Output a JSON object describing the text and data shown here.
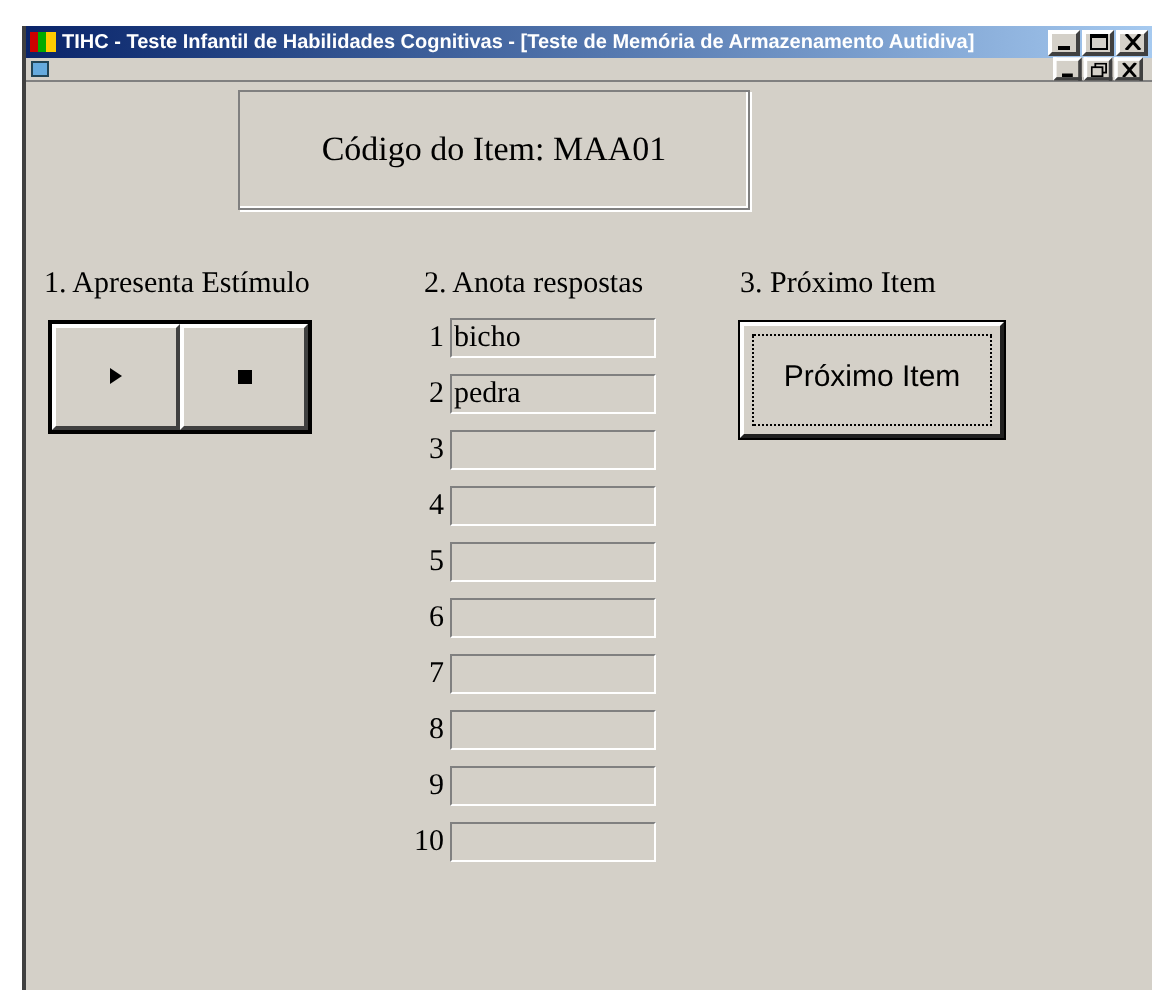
{
  "window": {
    "title": "TIHC - Teste Infantil de Habilidades Cognitivas - [Teste de Memória de Armazenamento Autidiva]"
  },
  "item_code": "Código do Item: MAA01",
  "step1": {
    "heading": "1. Apresenta Estímulo"
  },
  "step2": {
    "heading": "2. Anota respostas",
    "answers": [
      {
        "number": "1",
        "value": "bicho"
      },
      {
        "number": "2",
        "value": "pedra"
      },
      {
        "number": "3"
      },
      {
        "number": "4"
      },
      {
        "number": "5"
      },
      {
        "number": "6"
      },
      {
        "number": "7"
      },
      {
        "number": "8"
      },
      {
        "number": "9"
      },
      {
        "number": "10"
      }
    ]
  },
  "step3": {
    "heading": "3. Próximo Item",
    "button": "Próximo Item"
  }
}
